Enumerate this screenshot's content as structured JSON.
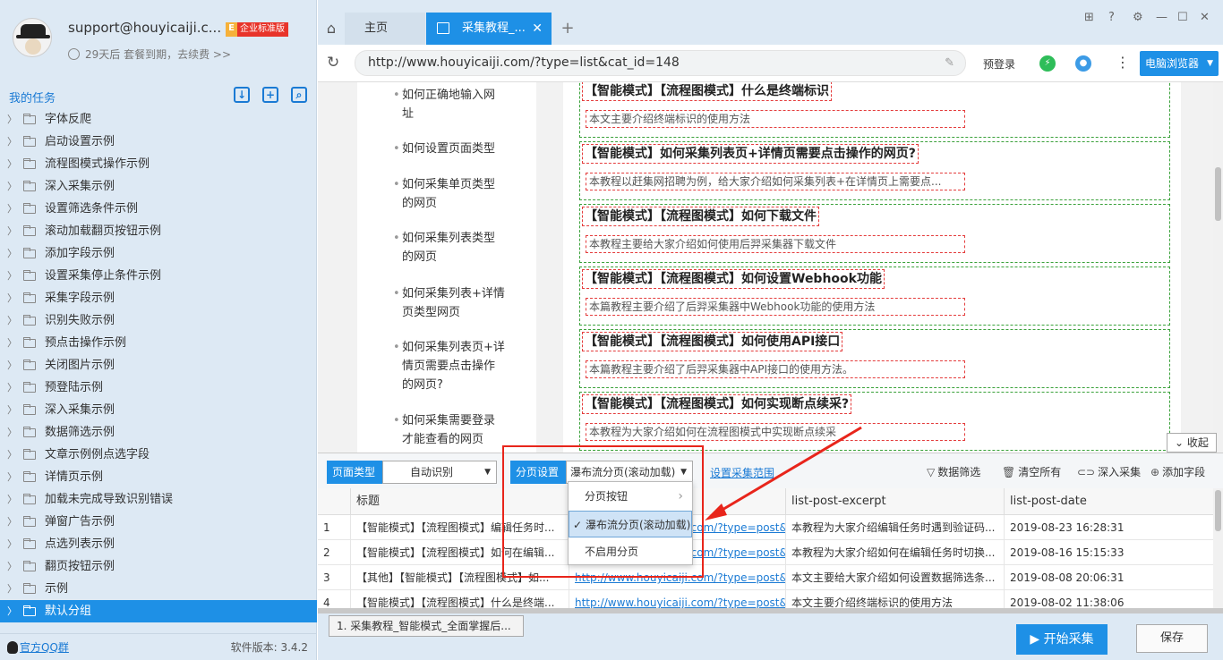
{
  "profile": {
    "email": "support@houyicaiji.c...",
    "badge_e": "E",
    "badge_label": "企业标准版",
    "expire_text": "29天后 套餐到期，去续费 >>"
  },
  "tasks": {
    "title": "我的任务",
    "items": [
      "字体反爬",
      "启动设置示例",
      "流程图模式操作示例",
      "深入采集示例",
      "设置筛选条件示例",
      "滚动加载翻页按钮示例",
      "添加字段示例",
      "设置采集停止条件示例",
      "采集字段示例",
      "识别失败示例",
      "预点击操作示例",
      "关闭图片示例",
      "预登陆示例",
      "深入采集示例",
      "数据筛选示例",
      "文章示例例点选字段",
      "详情页示例",
      "加载未完成导致识别错误",
      "弹窗广告示例",
      "点选列表示例",
      "翻页按钮示例",
      "示例",
      "默认分组"
    ],
    "active_index": 22
  },
  "sidebar_footer": {
    "qq_group": "官方QQ群",
    "version": "软件版本: 3.4.2"
  },
  "tabs": {
    "home": "主页",
    "active": "采集教程_..."
  },
  "address": {
    "url": "http://www.houyicaiji.com/?type=list&cat_id=148",
    "login": "预登录",
    "browser": "电脑浏览器"
  },
  "webpage": {
    "nav": [
      "如何正确地输入网",
      "址",
      "如何设置页面类型",
      "如何采集单页类型",
      "的网页",
      "如何采集列表类型",
      "的网页",
      "如何采集列表+详情",
      "页类型网页",
      "如何采集列表页+详",
      "情页需要点击操作",
      "的网页?",
      "如何采集需要登录",
      "才能查看的网页"
    ],
    "articles": [
      {
        "title": "【智能模式】【流程图模式】什么是终端标识",
        "desc": "本文主要介绍终端标识的使用方法"
      },
      {
        "title": "【智能模式】如何采集列表页+详情页需要点击操作的网页?",
        "desc": "本教程以赶集网招聘为例，给大家介绍如何采集列表+在详情页上需要点..."
      },
      {
        "title": "【智能模式】【流程图模式】如何下载文件",
        "desc": "本教程主要给大家介绍如何使用后羿采集器下载文件"
      },
      {
        "title": "【智能模式】【流程图模式】如何设置Webhook功能",
        "desc": "本篇教程主要介绍了后羿采集器中Webhook功能的使用方法"
      },
      {
        "title": "【智能模式】【流程图模式】如何使用API接口",
        "desc": "本篇教程主要介绍了后羿采集器中API接口的使用方法。"
      },
      {
        "title": "【智能模式】【流程图模式】如何实现断点续采?",
        "desc": "本教程为大家介绍如何在流程图模式中实现断点续采"
      }
    ],
    "collapse": "收起"
  },
  "config": {
    "page_type_label": "页面类型",
    "page_type_value": "自动识别",
    "paging_label": "分页设置",
    "paging_value": "瀑布流分页(滚动加载)",
    "range_link": "设置采集范围",
    "filter": "数据筛选",
    "clear": "清空所有",
    "deep": "深入采集",
    "add_field": "添加字段"
  },
  "dropdown": {
    "items": [
      "分页按钮",
      "瀑布流分页(滚动加载)",
      "不启用分页"
    ],
    "selected_index": 1
  },
  "table": {
    "headers": [
      "标题",
      "",
      "list-post-excerpt",
      "list-post-date"
    ],
    "rows": [
      {
        "n": "1",
        "title": "【智能模式】【流程图模式】编辑任务时...",
        "link": "http://www.houyicaiji.com/?type=post&pi...",
        "excerpt": "本教程为大家介绍编辑任务时遇到验证码...",
        "date": "2019-08-23 16:28:31"
      },
      {
        "n": "2",
        "title": "【智能模式】【流程图模式】如何在编辑...",
        "link": "http://www.houyicaiji.com/?type=post&pi...",
        "excerpt": "本教程为大家介绍如何在编辑任务时切换...",
        "date": "2019-08-16 15:15:33"
      },
      {
        "n": "3",
        "title": "【其他】【智能模式】【流程图模式】如...",
        "link": "http://www.houyicaiji.com/?type=post&pi...",
        "excerpt": "本文主要给大家介绍如何设置数据筛选条...",
        "date": "2019-08-08 20:06:31"
      },
      {
        "n": "4",
        "title": "【智能模式】【流程图模式】什么是终端...",
        "link": "http://www.houyicaiji.com/?type=post&pi...",
        "excerpt": "本文主要介绍终端标识的使用方法",
        "date": "2019-08-02 11:38:06"
      }
    ]
  },
  "bottom": {
    "task_tab": "1. 采集教程_智能模式_全面掌握后...",
    "start": "开始采集",
    "save": "保存"
  },
  "colors": {
    "accent": "#1e90e6",
    "annotation": "#e8251b",
    "sidebar_bg": "#dde9f4"
  }
}
